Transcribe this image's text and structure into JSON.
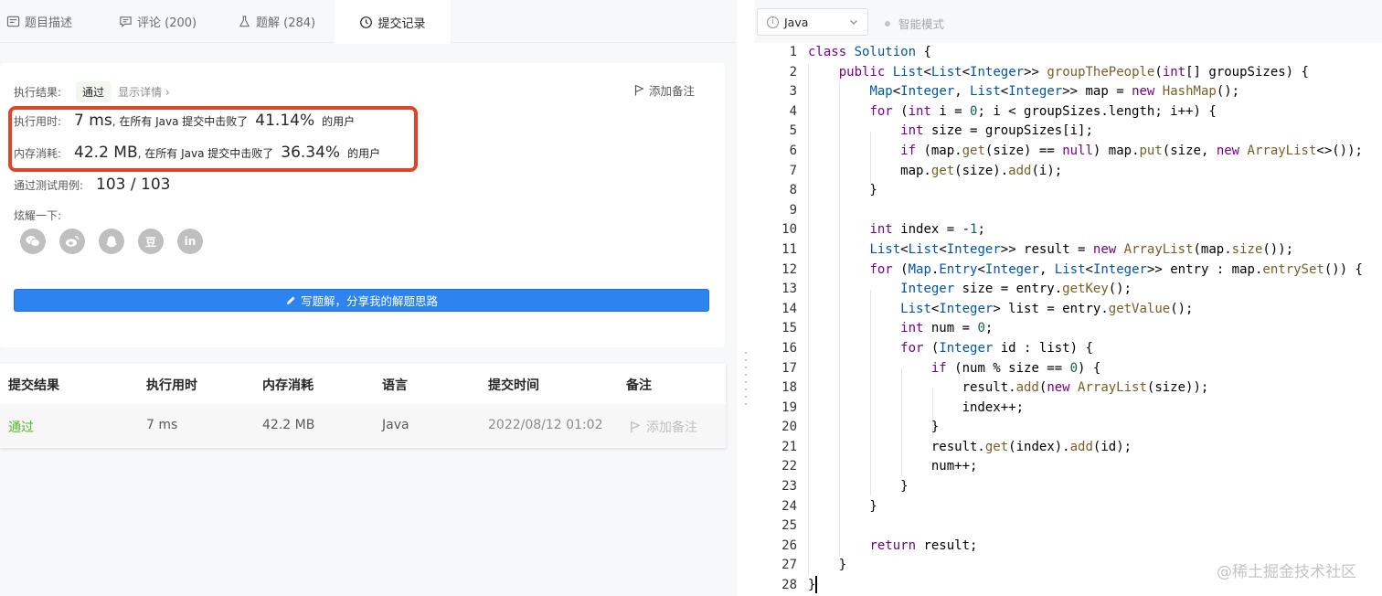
{
  "tabs": [
    {
      "label": "题目描述",
      "icon": "description-icon"
    },
    {
      "label": "评论 (200)",
      "icon": "comment-icon"
    },
    {
      "label": "题解 (284)",
      "icon": "flask-icon"
    },
    {
      "label": "提交记录",
      "icon": "clock-icon"
    }
  ],
  "result": {
    "label": "执行结果:",
    "status": "通过",
    "detail": "显示详情 ›",
    "add_note": "添加备注"
  },
  "runtime": {
    "label": "执行用时:",
    "value": "7 ms",
    "mid": ", 在所有 Java 提交中击败了",
    "percent": "41.14%",
    "suffix": "的用户"
  },
  "memory": {
    "label": "内存消耗:",
    "value": "42.2 MB",
    "mid": ", 在所有 Java 提交中击败了",
    "percent": "36.34%",
    "suffix": "的用户"
  },
  "tests": {
    "label": "通过测试用例:",
    "value": "103 / 103"
  },
  "share": {
    "label": "炫耀一下:",
    "icons": [
      "wechat-icon",
      "weibo-icon",
      "qq-icon",
      "douban-icon",
      "linkedin-icon"
    ],
    "douban_char": "豆",
    "linkedin_text": "in"
  },
  "write_solution": "写题解，分享我的解题思路",
  "table": {
    "headers": [
      "提交结果",
      "执行用时",
      "内存消耗",
      "语言",
      "提交时间",
      "备注"
    ],
    "row": {
      "status": "通过",
      "runtime": "7 ms",
      "memory": "42.2 MB",
      "language": "Java",
      "time": "2022/08/12 01:02",
      "note": "添加备注"
    }
  },
  "editor": {
    "language": "Java",
    "mode": "智能模式",
    "code": [
      [
        [
          "class ",
          "kw"
        ],
        [
          "Solution ",
          "tp"
        ],
        [
          "{",
          ""
        ]
      ],
      [
        [
          "    ",
          ""
        ],
        [
          "public ",
          "kw"
        ],
        [
          "List",
          "tp"
        ],
        [
          "<",
          ""
        ],
        [
          "List",
          "tp"
        ],
        [
          "<",
          ""
        ],
        [
          "Integer",
          "tp"
        ],
        [
          ">> ",
          ""
        ],
        [
          "groupThePeople",
          "fn"
        ],
        [
          "(",
          ""
        ],
        [
          "int",
          "kw"
        ],
        [
          "[] groupSizes) {",
          ""
        ]
      ],
      [
        [
          "        ",
          ""
        ],
        [
          "Map",
          "tp"
        ],
        [
          "<",
          ""
        ],
        [
          "Integer",
          "tp"
        ],
        [
          ", ",
          ""
        ],
        [
          "List",
          "tp"
        ],
        [
          "<",
          ""
        ],
        [
          "Integer",
          "tp"
        ],
        [
          ">> map = ",
          ""
        ],
        [
          "new ",
          "kw"
        ],
        [
          "HashMap",
          "fn"
        ],
        [
          "();",
          ""
        ]
      ],
      [
        [
          "        ",
          ""
        ],
        [
          "for ",
          "kw"
        ],
        [
          "(",
          ""
        ],
        [
          "int ",
          "kw"
        ],
        [
          "i = ",
          ""
        ],
        [
          "0",
          "num"
        ],
        [
          "; i < groupSizes.length; i++) {",
          ""
        ]
      ],
      [
        [
          "            ",
          ""
        ],
        [
          "int ",
          "kw"
        ],
        [
          "size = groupSizes[i];",
          ""
        ]
      ],
      [
        [
          "            ",
          ""
        ],
        [
          "if ",
          "kw"
        ],
        [
          "(map.",
          ""
        ],
        [
          "get",
          "fn"
        ],
        [
          "(size) == ",
          ""
        ],
        [
          "null",
          "kw"
        ],
        [
          ") map.",
          ""
        ],
        [
          "put",
          "fn"
        ],
        [
          "(size, ",
          ""
        ],
        [
          "new ",
          "kw"
        ],
        [
          "ArrayList",
          "fn"
        ],
        [
          "<>());",
          ""
        ]
      ],
      [
        [
          "            map.",
          ""
        ],
        [
          "get",
          "fn"
        ],
        [
          "(size).",
          ""
        ],
        [
          "add",
          "fn"
        ],
        [
          "(i);",
          ""
        ]
      ],
      [
        [
          "        }",
          ""
        ]
      ],
      [
        [
          "",
          ""
        ]
      ],
      [
        [
          "        ",
          ""
        ],
        [
          "int ",
          "kw"
        ],
        [
          "index = -",
          ""
        ],
        [
          "1",
          "num"
        ],
        [
          ";",
          ""
        ]
      ],
      [
        [
          "        ",
          ""
        ],
        [
          "List",
          "tp"
        ],
        [
          "<",
          ""
        ],
        [
          "List",
          "tp"
        ],
        [
          "<",
          ""
        ],
        [
          "Integer",
          "tp"
        ],
        [
          ">> result = ",
          ""
        ],
        [
          "new ",
          "kw"
        ],
        [
          "ArrayList",
          "fn"
        ],
        [
          "(map.",
          ""
        ],
        [
          "size",
          "fn"
        ],
        [
          "());",
          ""
        ]
      ],
      [
        [
          "        ",
          ""
        ],
        [
          "for ",
          "kw"
        ],
        [
          "(",
          ""
        ],
        [
          "Map",
          "tp"
        ],
        [
          ".",
          ""
        ],
        [
          "Entry",
          "tp"
        ],
        [
          "<",
          ""
        ],
        [
          "Integer",
          "tp"
        ],
        [
          ", ",
          ""
        ],
        [
          "List",
          "tp"
        ],
        [
          "<",
          ""
        ],
        [
          "Integer",
          "tp"
        ],
        [
          ">> entry : map.",
          ""
        ],
        [
          "entrySet",
          "fn"
        ],
        [
          "()) {",
          ""
        ]
      ],
      [
        [
          "            ",
          ""
        ],
        [
          "Integer ",
          "tp"
        ],
        [
          "size = entry.",
          ""
        ],
        [
          "getKey",
          "fn"
        ],
        [
          "();",
          ""
        ]
      ],
      [
        [
          "            ",
          ""
        ],
        [
          "List",
          "tp"
        ],
        [
          "<",
          ""
        ],
        [
          "Integer",
          "tp"
        ],
        [
          "> list = entry.",
          ""
        ],
        [
          "getValue",
          "fn"
        ],
        [
          "();",
          ""
        ]
      ],
      [
        [
          "            ",
          ""
        ],
        [
          "int ",
          "kw"
        ],
        [
          "num = ",
          ""
        ],
        [
          "0",
          "num"
        ],
        [
          ";",
          ""
        ]
      ],
      [
        [
          "            ",
          ""
        ],
        [
          "for ",
          "kw"
        ],
        [
          "(",
          ""
        ],
        [
          "Integer ",
          "tp"
        ],
        [
          "id : list) {",
          ""
        ]
      ],
      [
        [
          "                ",
          ""
        ],
        [
          "if ",
          "kw"
        ],
        [
          "(num % size == ",
          ""
        ],
        [
          "0",
          "num"
        ],
        [
          ") {",
          ""
        ]
      ],
      [
        [
          "                    result.",
          ""
        ],
        [
          "add",
          "fn"
        ],
        [
          "(",
          ""
        ],
        [
          "new ",
          "kw"
        ],
        [
          "ArrayList",
          "fn"
        ],
        [
          "(size));",
          ""
        ]
      ],
      [
        [
          "                    index++;",
          ""
        ]
      ],
      [
        [
          "                }",
          ""
        ]
      ],
      [
        [
          "                result.",
          ""
        ],
        [
          "get",
          "fn"
        ],
        [
          "(index).",
          ""
        ],
        [
          "add",
          "fn"
        ],
        [
          "(id);",
          ""
        ]
      ],
      [
        [
          "                num++;",
          ""
        ]
      ],
      [
        [
          "            }",
          ""
        ]
      ],
      [
        [
          "        }",
          ""
        ]
      ],
      [
        [
          "",
          ""
        ]
      ],
      [
        [
          "        ",
          ""
        ],
        [
          "return ",
          "kw"
        ],
        [
          "result;",
          ""
        ]
      ],
      [
        [
          "    }",
          ""
        ]
      ],
      [
        [
          "}",
          ""
        ]
      ]
    ]
  },
  "watermark": "@稀土掘金技术社区",
  "colors": {
    "keyword": "#770088",
    "type": "#0055aa",
    "function": "#795e26",
    "number": "#116644",
    "accent": "#2d83f0",
    "success": "#5cb32a",
    "highlight": "#e0452b"
  }
}
